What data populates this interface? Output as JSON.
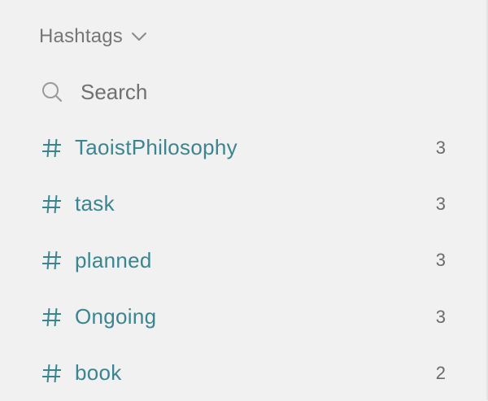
{
  "section": {
    "title": "Hashtags",
    "collapse_icon": "chevron-down-icon"
  },
  "search": {
    "placeholder": "Search",
    "value": "",
    "icon": "search-icon"
  },
  "tags": [
    {
      "name": "TaoistPhilosophy",
      "count": "3"
    },
    {
      "name": "task",
      "count": "3"
    },
    {
      "name": "planned",
      "count": "3"
    },
    {
      "name": "Ongoing",
      "count": "3"
    },
    {
      "name": "book",
      "count": "2"
    }
  ],
  "colors": {
    "background": "#f1f1f1",
    "tag_accent": "#3b8590",
    "muted_text": "#767676"
  }
}
